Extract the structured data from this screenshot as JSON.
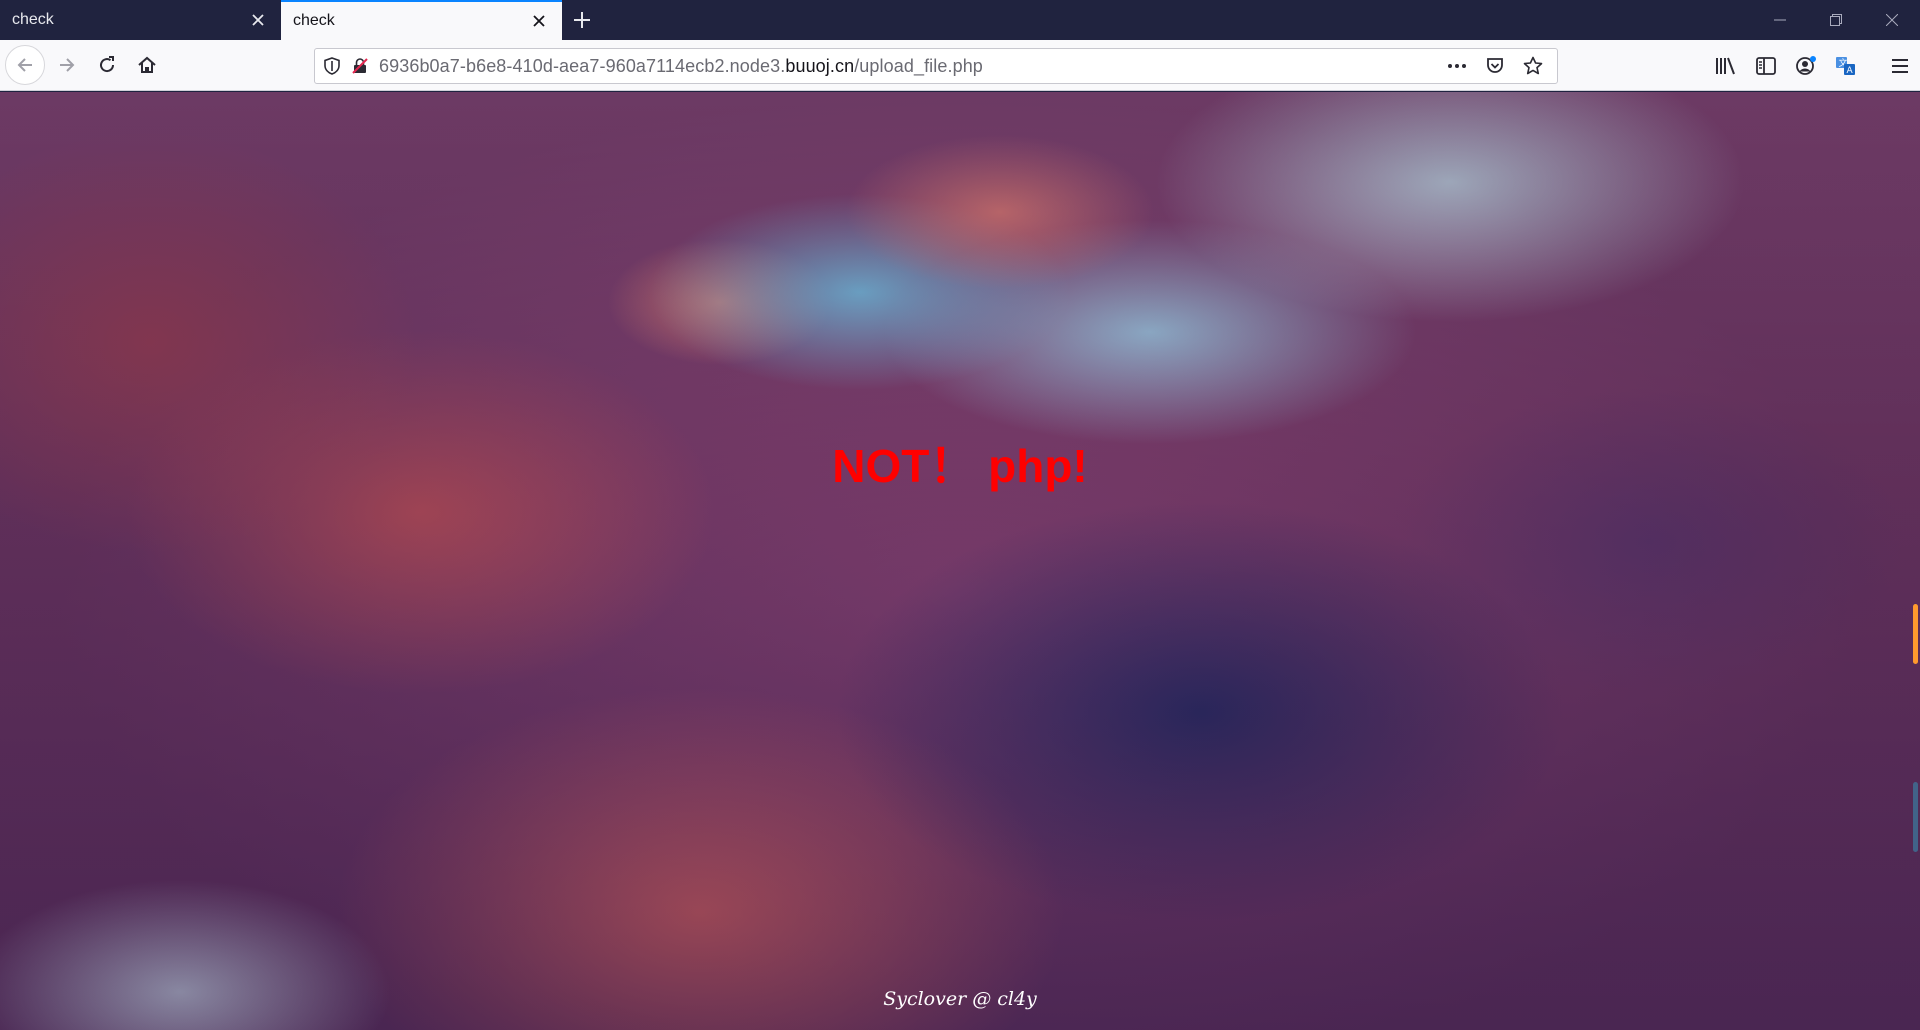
{
  "tabs": [
    {
      "title": "check",
      "active": false
    },
    {
      "title": "check",
      "active": true
    }
  ],
  "urlbar": {
    "prefix": "6936b0a7-b6e8-410d-aea7-960a7114ecb2.node3.",
    "domain": "buuoj.cn",
    "path": "/upload_file.php"
  },
  "page": {
    "message": "NOT！ php!",
    "footer": "Syclover @ cl4y"
  },
  "colors": {
    "message": "#ff0000",
    "tab_accent": "#0a84ff"
  }
}
